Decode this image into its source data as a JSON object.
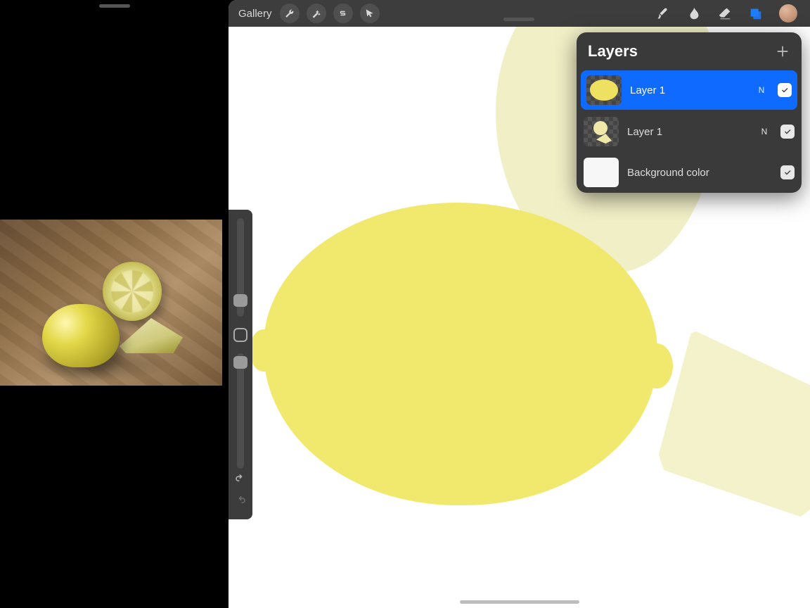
{
  "toolbar": {
    "gallery_label": "Gallery"
  },
  "layers_panel": {
    "title": "Layers",
    "rows": [
      {
        "name": "Layer 1",
        "blend": "N",
        "selected": true
      },
      {
        "name": "Layer 1",
        "blend": "N",
        "selected": false
      },
      {
        "name": "Background color",
        "blend": "",
        "selected": false
      }
    ]
  }
}
